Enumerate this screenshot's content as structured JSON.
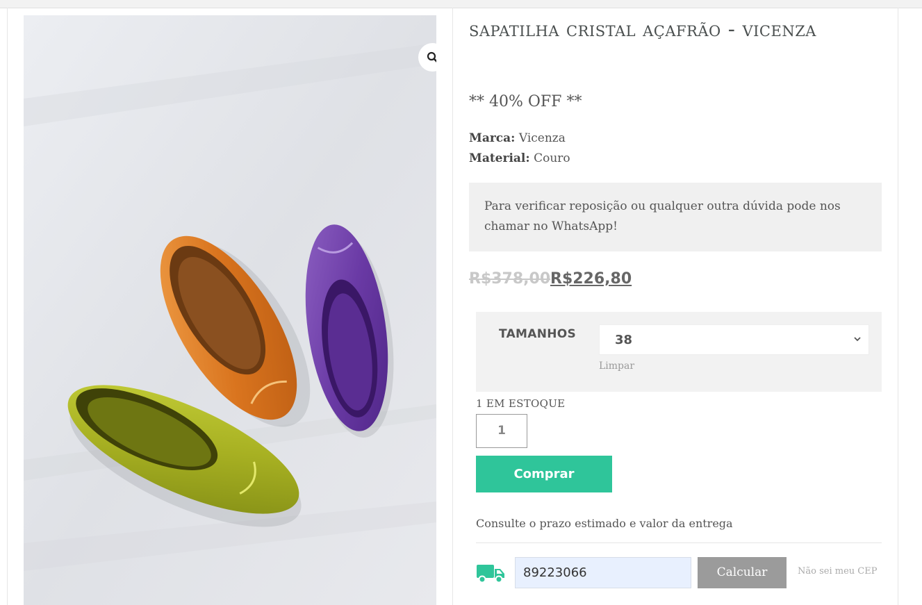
{
  "product": {
    "title": "Sapatilha Cristal Açafrão - Vicenza",
    "promo": "** 40% OFF **",
    "brand_label": "Marca:",
    "brand_value": "Vicenza",
    "material_label": "Material:",
    "material_value": "Couro",
    "notice": "Para verificar reposição ou qualquer outra dúvida pode nos chamar no WhatsApp!",
    "price_old": "R$378,00",
    "price_new": "R$226,80"
  },
  "variation": {
    "label": "TAMANHOS",
    "selected": "38",
    "clear": "Limpar"
  },
  "cart": {
    "stock": "1 EM ESTOQUE",
    "quantity": "1",
    "buy_label": "Comprar"
  },
  "shipping": {
    "text": "Consulte o prazo estimado e valor da entrega",
    "cep_value": "89223066",
    "calc_label": "Calcular",
    "no_cep_label": "Não sei meu CEP"
  },
  "icons": {
    "zoom": "magnifier-icon",
    "truck": "truck-icon",
    "chevron": "chevron-down-icon"
  },
  "colors": {
    "buy_button": "#2fc59a",
    "calc_button": "#9b9b9b",
    "cep_field": "#e8f0fe",
    "notice_bg": "#f0f0f0"
  }
}
